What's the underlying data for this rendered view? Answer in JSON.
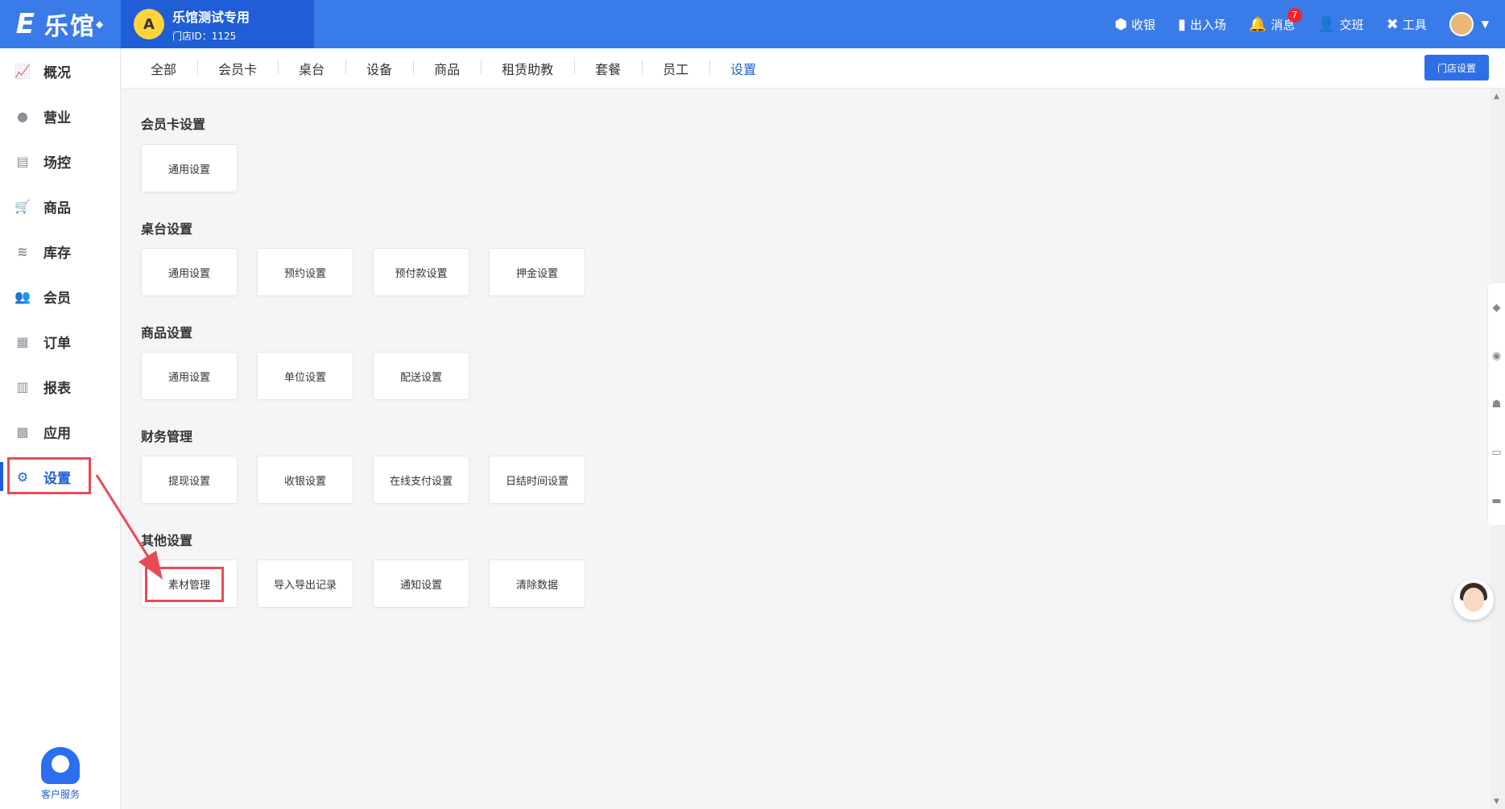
{
  "app": {
    "logo_text": "乐馆",
    "logo_mark": "E"
  },
  "store": {
    "avatar_text": "A",
    "name": "乐馆测试专用",
    "id_label": "门店ID：1125"
  },
  "topbar": {
    "actions": [
      {
        "label": "收银",
        "icon": "cashier-icon"
      },
      {
        "label": "出入场",
        "icon": "door-icon"
      },
      {
        "label": "消息",
        "icon": "bell-icon",
        "badge": "7"
      },
      {
        "label": "交班",
        "icon": "shift-icon"
      },
      {
        "label": "工具",
        "icon": "tools-icon"
      }
    ]
  },
  "sidebar": {
    "items": [
      {
        "label": "概况",
        "icon": "chart-icon"
      },
      {
        "label": "营业",
        "icon": "money-bag-icon"
      },
      {
        "label": "场控",
        "icon": "table-control-icon"
      },
      {
        "label": "商品",
        "icon": "cart-icon"
      },
      {
        "label": "库存",
        "icon": "layers-icon"
      },
      {
        "label": "会员",
        "icon": "member-icon"
      },
      {
        "label": "订单",
        "icon": "order-icon"
      },
      {
        "label": "报表",
        "icon": "report-icon"
      },
      {
        "label": "应用",
        "icon": "apps-icon"
      },
      {
        "label": "设置",
        "icon": "gear-icon",
        "active": true
      }
    ],
    "service_label": "客户服务"
  },
  "tabs": {
    "items": [
      "全部",
      "会员卡",
      "桌台",
      "设备",
      "商品",
      "租赁助教",
      "套餐",
      "员工",
      "设置"
    ],
    "active": "设置",
    "store_setting_button": "门店设置"
  },
  "sections": [
    {
      "title": "会员卡设置",
      "cards": [
        "通用设置"
      ]
    },
    {
      "title": "桌台设置",
      "cards": [
        "通用设置",
        "预约设置",
        "预付款设置",
        "押金设置"
      ]
    },
    {
      "title": "商品设置",
      "cards": [
        "通用设置",
        "单位设置",
        "配送设置"
      ]
    },
    {
      "title": "财务管理",
      "cards": [
        "提现设置",
        "收银设置",
        "在线支付设置",
        "日结时间设置"
      ]
    },
    {
      "title": "其他设置",
      "cards": [
        "素材管理",
        "导入导出记录",
        "通知设置",
        "清除数据"
      ]
    }
  ],
  "colors": {
    "primary": "#3a7bea",
    "store_bg": "#1f5ed6",
    "highlight": "#e94b55"
  }
}
